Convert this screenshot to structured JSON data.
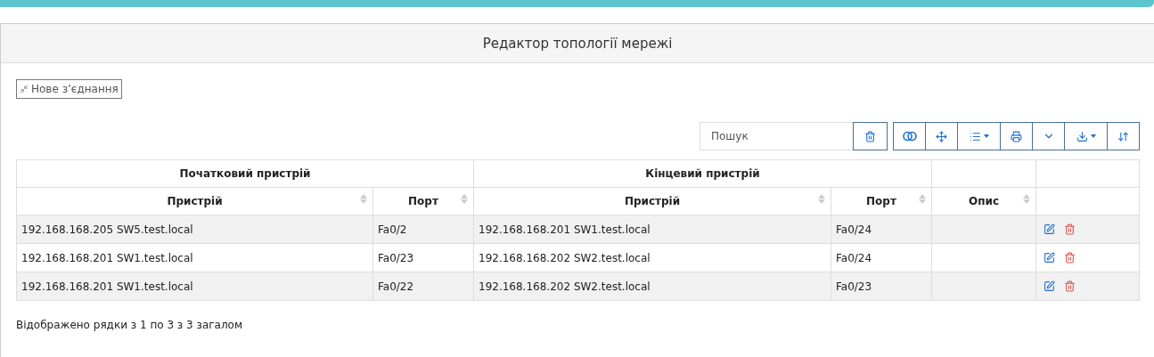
{
  "panel": {
    "title": "Редактор топології мережі"
  },
  "new_link_button": {
    "label": "Нове з’єднання"
  },
  "toolbar": {
    "search": {
      "placeholder": "Пошук"
    }
  },
  "table": {
    "groups": [
      {
        "label": "Початковий пристрій"
      },
      {
        "label": "Кінцевий пристрій"
      }
    ],
    "columns": [
      {
        "label": "Пристрій",
        "sortable": true
      },
      {
        "label": "Порт",
        "sortable": true
      },
      {
        "label": "Пристрій",
        "sortable": true
      },
      {
        "label": "Порт",
        "sortable": true
      },
      {
        "label": "Опис",
        "sortable": true
      },
      {
        "sortable": false
      }
    ],
    "rows": [
      {
        "cells": [
          "192.168.168.205 SW5.test.local",
          "Fa0/2",
          "192.168.168.201 SW1.test.local",
          "Fa0/24"
        ]
      },
      {
        "cells": [
          "192.168.168.201 SW1.test.local",
          "Fa0/23",
          "192.168.168.202 SW2.test.local",
          "Fa0/24"
        ]
      },
      {
        "cells": [
          "192.168.168.201 SW1.test.local",
          "Fa0/22",
          "192.168.168.202 SW2.test.local",
          "Fa0/23"
        ]
      }
    ]
  },
  "footer": "Відображено рядки з 1 по 3 з 3 загалом"
}
